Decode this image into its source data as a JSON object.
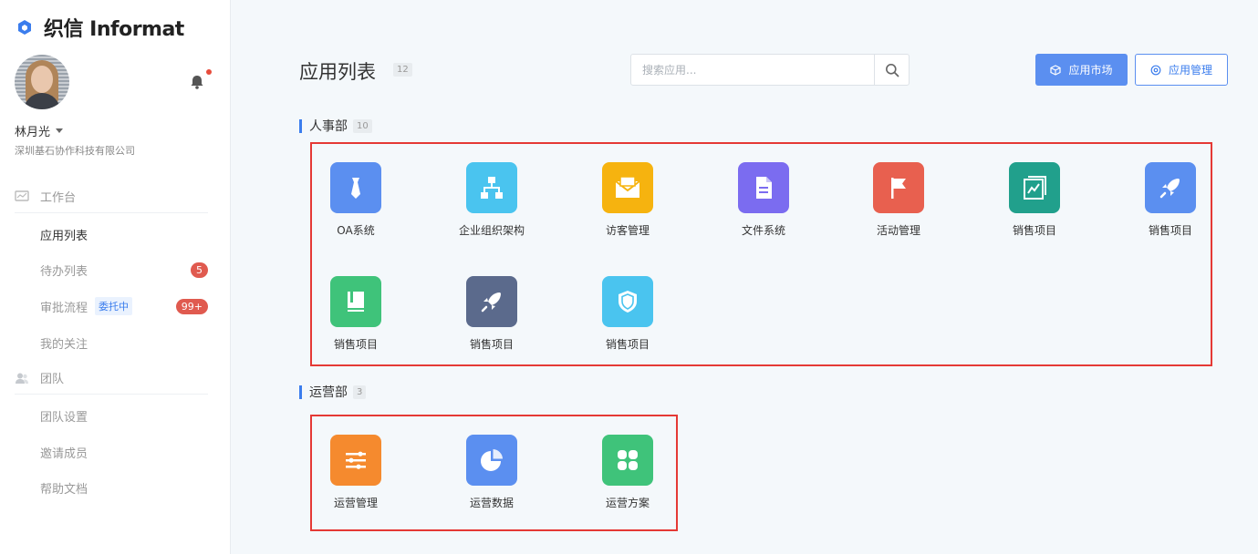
{
  "brand": {
    "name": "织信 Informat",
    "accent": "#3b7ded"
  },
  "user": {
    "name": "林月光",
    "company": "深圳基石协作科技有限公司"
  },
  "sidebar": {
    "workbench": "工作台",
    "items": [
      {
        "label": "应用列表"
      },
      {
        "label": "待办列表",
        "badge": "5"
      },
      {
        "label": "审批流程",
        "tag": "委托中",
        "badge": "99+"
      },
      {
        "label": "我的关注"
      }
    ],
    "team": "团队",
    "team_items": [
      {
        "label": "团队设置"
      },
      {
        "label": "邀请成员"
      },
      {
        "label": "帮助文档"
      }
    ]
  },
  "main": {
    "title": "应用列表",
    "count": "12",
    "search_placeholder": "搜索应用...",
    "market_button": "应用市场",
    "manage_button": "应用管理"
  },
  "sections": [
    {
      "name": "人事部",
      "count": "10",
      "apps": [
        {
          "label": "OA系统",
          "icon": "tie-icon",
          "color": "#5b8ff0"
        },
        {
          "label": "企业组织架构",
          "icon": "org-chart-icon",
          "color": "#4ac4ef"
        },
        {
          "label": "访客管理",
          "icon": "envelope-icon",
          "color": "#f6b30f"
        },
        {
          "label": "文件系统",
          "icon": "document-icon",
          "color": "#7b6cf0"
        },
        {
          "label": "活动管理",
          "icon": "flag-icon",
          "color": "#e8604f"
        },
        {
          "label": "销售项目",
          "icon": "chart-book-icon",
          "color": "#21a08c"
        },
        {
          "label": "销售项目",
          "icon": "rocket-icon",
          "color": "#5b8ff0"
        },
        {
          "label": "销售项目",
          "icon": "book-icon",
          "color": "#3fc37a"
        },
        {
          "label": "销售项目",
          "icon": "rocket-icon",
          "color": "#5b6a8c"
        },
        {
          "label": "销售项目",
          "icon": "shield-icon",
          "color": "#4ac4ef"
        }
      ]
    },
    {
      "name": "运营部",
      "count": "3",
      "apps": [
        {
          "label": "运营管理",
          "icon": "sliders-icon",
          "color": "#f58a2e"
        },
        {
          "label": "运营数据",
          "icon": "pie-chart-icon",
          "color": "#5b8ff0"
        },
        {
          "label": "运营方案",
          "icon": "grid-icon",
          "color": "#3fc37a"
        }
      ]
    }
  ]
}
